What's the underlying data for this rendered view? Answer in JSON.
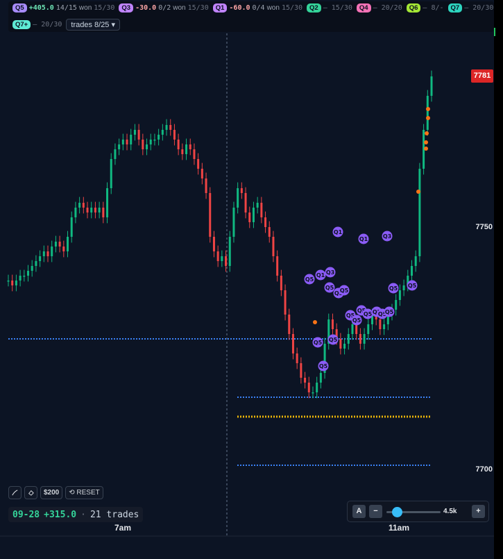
{
  "topbar": {
    "stats": [
      {
        "tag": "Q5",
        "color": "#a78bfa",
        "pnl": "+405.0",
        "pnl_color": "#6ee7b7",
        "record": "14/15",
        "won": "won",
        "range": "15/30"
      },
      {
        "tag": "Q3",
        "color": "#c084fc",
        "pnl": "-30.0",
        "pnl_color": "#fca5a5",
        "record": "0/2",
        "won": "won",
        "range": "15/30"
      },
      {
        "tag": "Q1",
        "color": "#c084fc",
        "pnl": "-60.0",
        "pnl_color": "#fca5a5",
        "record": "0/4",
        "won": "won",
        "range": "15/30"
      },
      {
        "tag": "Q2",
        "color": "#34d399",
        "text": "– 15/30"
      },
      {
        "tag": "Q4",
        "color": "#f472b6",
        "text": "– 20/20"
      },
      {
        "tag": "Q6",
        "color": "#a3e635",
        "text": "– 8/-"
      },
      {
        "tag": "Q7",
        "color": "#2dd4bf",
        "text": "– 20/30"
      }
    ],
    "row2": {
      "tag": "Q7+",
      "color": "#5eead4",
      "text": "– 20/30",
      "trades_button": "trades 8/25 ▾"
    }
  },
  "price_axis": {
    "labels": [
      "7750",
      "7700"
    ],
    "last_price": "7781"
  },
  "time_axis": {
    "labels": [
      "7am",
      "11am"
    ]
  },
  "toolbar": {
    "pen_icon": "pen-icon",
    "eraser_icon": "eraser-icon",
    "amount": "$200",
    "reset": "⟲ RESET"
  },
  "summary": {
    "date": "09-28",
    "pnl": "+315.0",
    "separator": "·",
    "trades": "21 trades"
  },
  "zoom": {
    "a": "A",
    "minus": "−",
    "value": "4.5k",
    "plus": "+",
    "level": 0.2
  },
  "chart_data": {
    "type": "candlestick",
    "y_range": [
      7680,
      7790
    ],
    "candle_series": [
      7739,
      7738,
      7739,
      7740,
      7740,
      7741,
      7742,
      7743,
      7744,
      7745,
      7744,
      7746,
      7747,
      7746,
      7745,
      7748,
      7752,
      7754,
      7755,
      7754,
      7753,
      7754,
      7753,
      7754,
      7752,
      7758,
      7764,
      7766,
      7767,
      7768,
      7767,
      7769,
      7770,
      7768,
      7766,
      7767,
      7768,
      7768,
      7769,
      7770,
      7771,
      7770,
      7768,
      7766,
      7765,
      7767,
      7766,
      7764,
      7762,
      7760,
      7757,
      7748,
      7745,
      7743,
      7744,
      7742,
      7748,
      7754,
      7758,
      7757,
      7753,
      7751,
      7754,
      7755,
      7752,
      7750,
      7748,
      7744,
      7740,
      7737,
      7732,
      7728,
      7724,
      7722,
      7719,
      7718,
      7716,
      7716,
      7718,
      7720,
      7726,
      7731,
      7729,
      7727,
      7725,
      7726,
      7728,
      7730,
      7728,
      7726,
      7728,
      7730,
      7732,
      7731,
      7729,
      7730,
      7732,
      7733,
      7735,
      7737,
      7738,
      7740,
      7742,
      7744,
      7762,
      7770,
      7777,
      7781
    ],
    "levels": [
      {
        "price": 7727,
        "color": "#3b82f6"
      },
      {
        "price": 7715,
        "color": "#3b82f6"
      },
      {
        "price": 7711,
        "color": "#eab308"
      },
      {
        "price": 7701,
        "color": "#3b82f6"
      }
    ],
    "trade_markers": [
      "Q1",
      "Q5",
      "Q1",
      "Q3",
      "Q1",
      "Q3",
      "Q5",
      "Q5",
      "Q5",
      "Q5",
      "Q5",
      "Q5",
      "Q5",
      "Q5",
      "Q5",
      "Q5",
      "Q5",
      "Q5",
      "Q5",
      "Q5",
      "Q5"
    ]
  }
}
